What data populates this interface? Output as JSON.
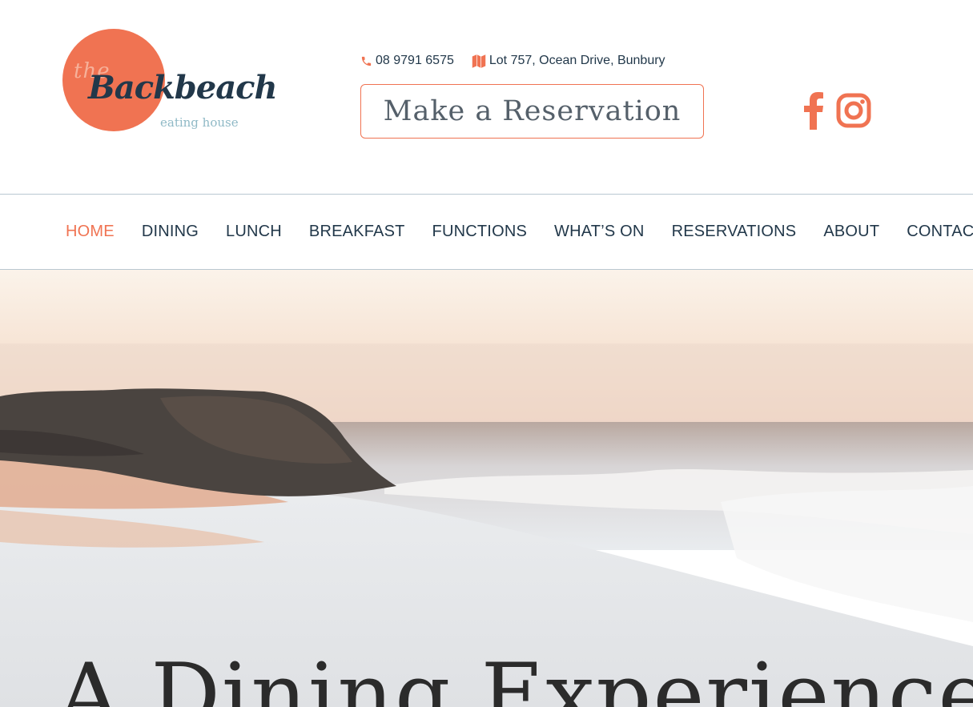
{
  "brand": {
    "logo_the": "the",
    "logo_name": "Backbeach",
    "logo_sub": "eating house"
  },
  "contact": {
    "phone": "08 9791 6575",
    "address": "Lot 757, Ocean Drive, Bunbury",
    "phone_icon": "phone-icon",
    "address_icon": "map-icon"
  },
  "reservation_button": {
    "label": "Make a Reservation"
  },
  "social": {
    "facebook_icon": "facebook-icon",
    "instagram_icon": "instagram-icon"
  },
  "nav": {
    "items": [
      {
        "label": "HOME"
      },
      {
        "label": "DINING"
      },
      {
        "label": "LUNCH"
      },
      {
        "label": "BREAKFAST"
      },
      {
        "label": "FUNCTIONS"
      },
      {
        "label": "WHAT’S ON"
      },
      {
        "label": "RESERVATIONS"
      },
      {
        "label": "ABOUT"
      },
      {
        "label": "CONTACT"
      }
    ],
    "active_index": 0
  },
  "hero": {
    "title": "A Dining Experience"
  },
  "colors": {
    "accent": "#f07352",
    "text_dark": "#22384a",
    "nav_border": "#b9c8d1"
  }
}
